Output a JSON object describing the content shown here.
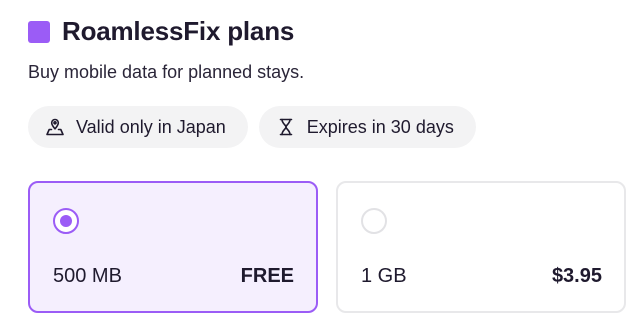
{
  "header": {
    "title": "RoamlessFix plans",
    "logo_color": "#9b5cf6"
  },
  "subtitle": "Buy mobile data for planned stays.",
  "chips": [
    {
      "icon": "location-pin-icon",
      "label": "Valid only in Japan"
    },
    {
      "icon": "hourglass-icon",
      "label": "Expires in 30 days"
    }
  ],
  "plans": [
    {
      "name": "500 MB",
      "price": "FREE",
      "selected": true
    },
    {
      "name": "1 GB",
      "price": "$3.95",
      "selected": false
    }
  ],
  "colors": {
    "accent": "#9b5cf6",
    "selected_bg": "#f5effe",
    "chip_bg": "#f3f3f4"
  }
}
